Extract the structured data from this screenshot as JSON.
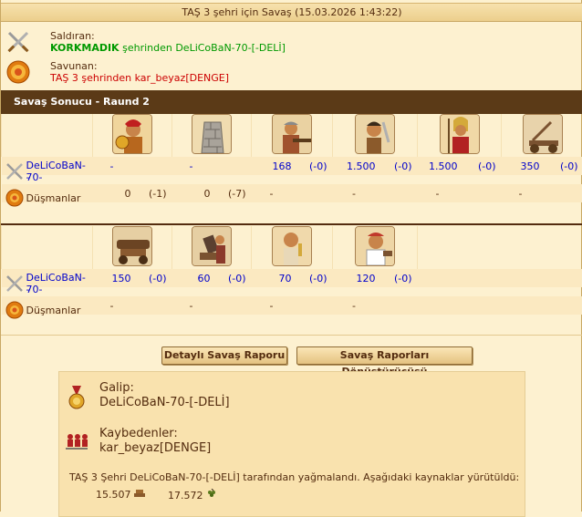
{
  "window": {
    "title": "TAŞ 3 şehri için Savaş (15.03.2026 1:43:22)"
  },
  "attacker": {
    "label": "Saldıran:",
    "city": "KORKMADIK",
    "text": "şehrinden DeLiCoBaN-70-[-DELİ]"
  },
  "defender": {
    "label": "Savunan:",
    "text": "TAŞ 3 şehrinden kar_beyaz[DENGE]"
  },
  "round": {
    "title": "Savaş Sonucu - Raund 2"
  },
  "section1": {
    "icons": [
      "hoplite-unit-icon",
      "wall-unit-icon",
      "sulfur-carabineer-unit-icon",
      "swordsman-unit-icon",
      "spearman-unit-icon",
      "catapult-unit-icon"
    ],
    "attacker": {
      "name": "DeLiCoBaN-70-",
      "cells": [
        {
          "count": "-",
          "loss": ""
        },
        {
          "count": "-",
          "loss": ""
        },
        {
          "count": "168",
          "loss": "(-0)"
        },
        {
          "count": "1.500",
          "loss": "(-0)"
        },
        {
          "count": "1.500",
          "loss": "(-0)"
        },
        {
          "count": "350",
          "loss": "(-0)"
        }
      ]
    },
    "enemy": {
      "name": "Düşmanlar",
      "cells": [
        {
          "count": "0",
          "loss": "(-1)"
        },
        {
          "count": "0",
          "loss": "(-7)"
        },
        {
          "count": "-",
          "loss": ""
        },
        {
          "count": "-",
          "loss": ""
        },
        {
          "count": "-",
          "loss": ""
        },
        {
          "count": "-",
          "loss": ""
        }
      ]
    }
  },
  "section2": {
    "icons": [
      "ram-unit-icon",
      "mortar-unit-icon",
      "doctor-unit-icon",
      "cook-unit-icon"
    ],
    "attacker": {
      "name": "DeLiCoBaN-70-",
      "cells": [
        {
          "count": "150",
          "loss": "(-0)"
        },
        {
          "count": "60",
          "loss": "(-0)"
        },
        {
          "count": "70",
          "loss": "(-0)"
        },
        {
          "count": "120",
          "loss": "(-0)"
        }
      ]
    },
    "enemy": {
      "name": "Düşmanlar",
      "cells": [
        {
          "count": "-",
          "loss": ""
        },
        {
          "count": "-",
          "loss": ""
        },
        {
          "count": "-",
          "loss": ""
        },
        {
          "count": "-",
          "loss": ""
        }
      ]
    }
  },
  "buttons": {
    "detail": "Detaylı Savaş Raporu",
    "converter": "Savaş Raporları Dönüştürücüsü"
  },
  "result": {
    "winner_label": "Galip:",
    "winner": "DeLiCoBaN-70-[-DELİ]",
    "loser_label": "Kaybedenler:",
    "loser": "kar_beyaz[DENGE]",
    "plunder_text": "TAŞ 3 Şehri DeLiCoBaN-70-[-DELİ] tarafından yağmalandı. Aşağıdaki kaynaklar yürütüldü:",
    "resources": [
      {
        "amount": "15.507",
        "icon": "wood-icon"
      },
      {
        "amount": "17.572",
        "icon": "wine-icon"
      }
    ]
  },
  "colors": {
    "background": "#fdf1d0",
    "round_bar": "#5b3a17",
    "link": "#0000cc",
    "attacker_city": "#009900",
    "defender": "#cc0000"
  }
}
